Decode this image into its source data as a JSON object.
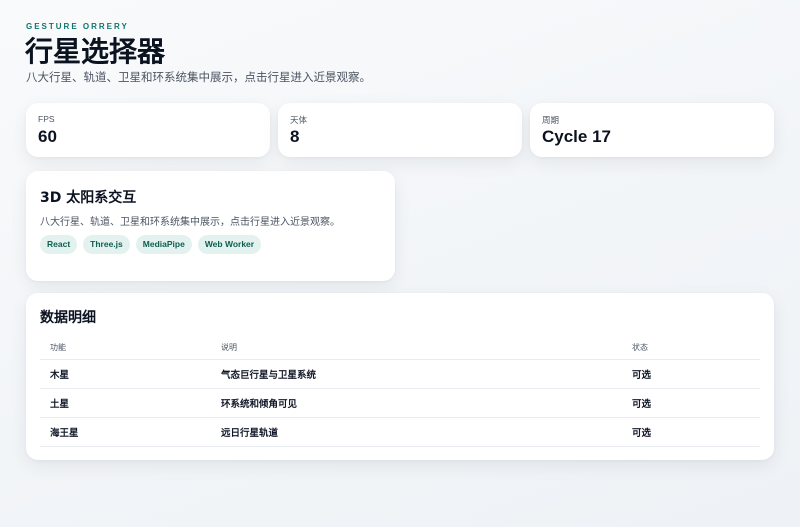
{
  "header": {
    "eyebrow": "GESTURE ORRERY",
    "title": "行星选择器",
    "subtitle": "八大行星、轨道、卫星和环系统集中展示，点击行星进入近景观察。"
  },
  "stats": [
    {
      "label": "FPS",
      "value": "60"
    },
    {
      "label": "天体",
      "value": "8"
    },
    {
      "label": "周期",
      "value": "Cycle 17"
    }
  ],
  "feature": {
    "title": "3D 太阳系交互",
    "description": "八大行星、轨道、卫星和环系统集中展示，点击行星进入近景观察。",
    "tags": [
      "React",
      "Three.js",
      "MediaPipe",
      "Web Worker"
    ]
  },
  "table": {
    "title": "数据明细",
    "columns": [
      "功能",
      "说明",
      "状态"
    ],
    "rows": [
      [
        "木星",
        "气态巨行星与卫星系统",
        "可选"
      ],
      [
        "土星",
        "环系统和倾角可见",
        "可选"
      ],
      [
        "海王星",
        "远日行星轨道",
        "可选"
      ]
    ]
  },
  "colors": {
    "accent": "#0f766e",
    "tag_bg": "#e3f2ee",
    "tag_text": "#0f5e52"
  }
}
